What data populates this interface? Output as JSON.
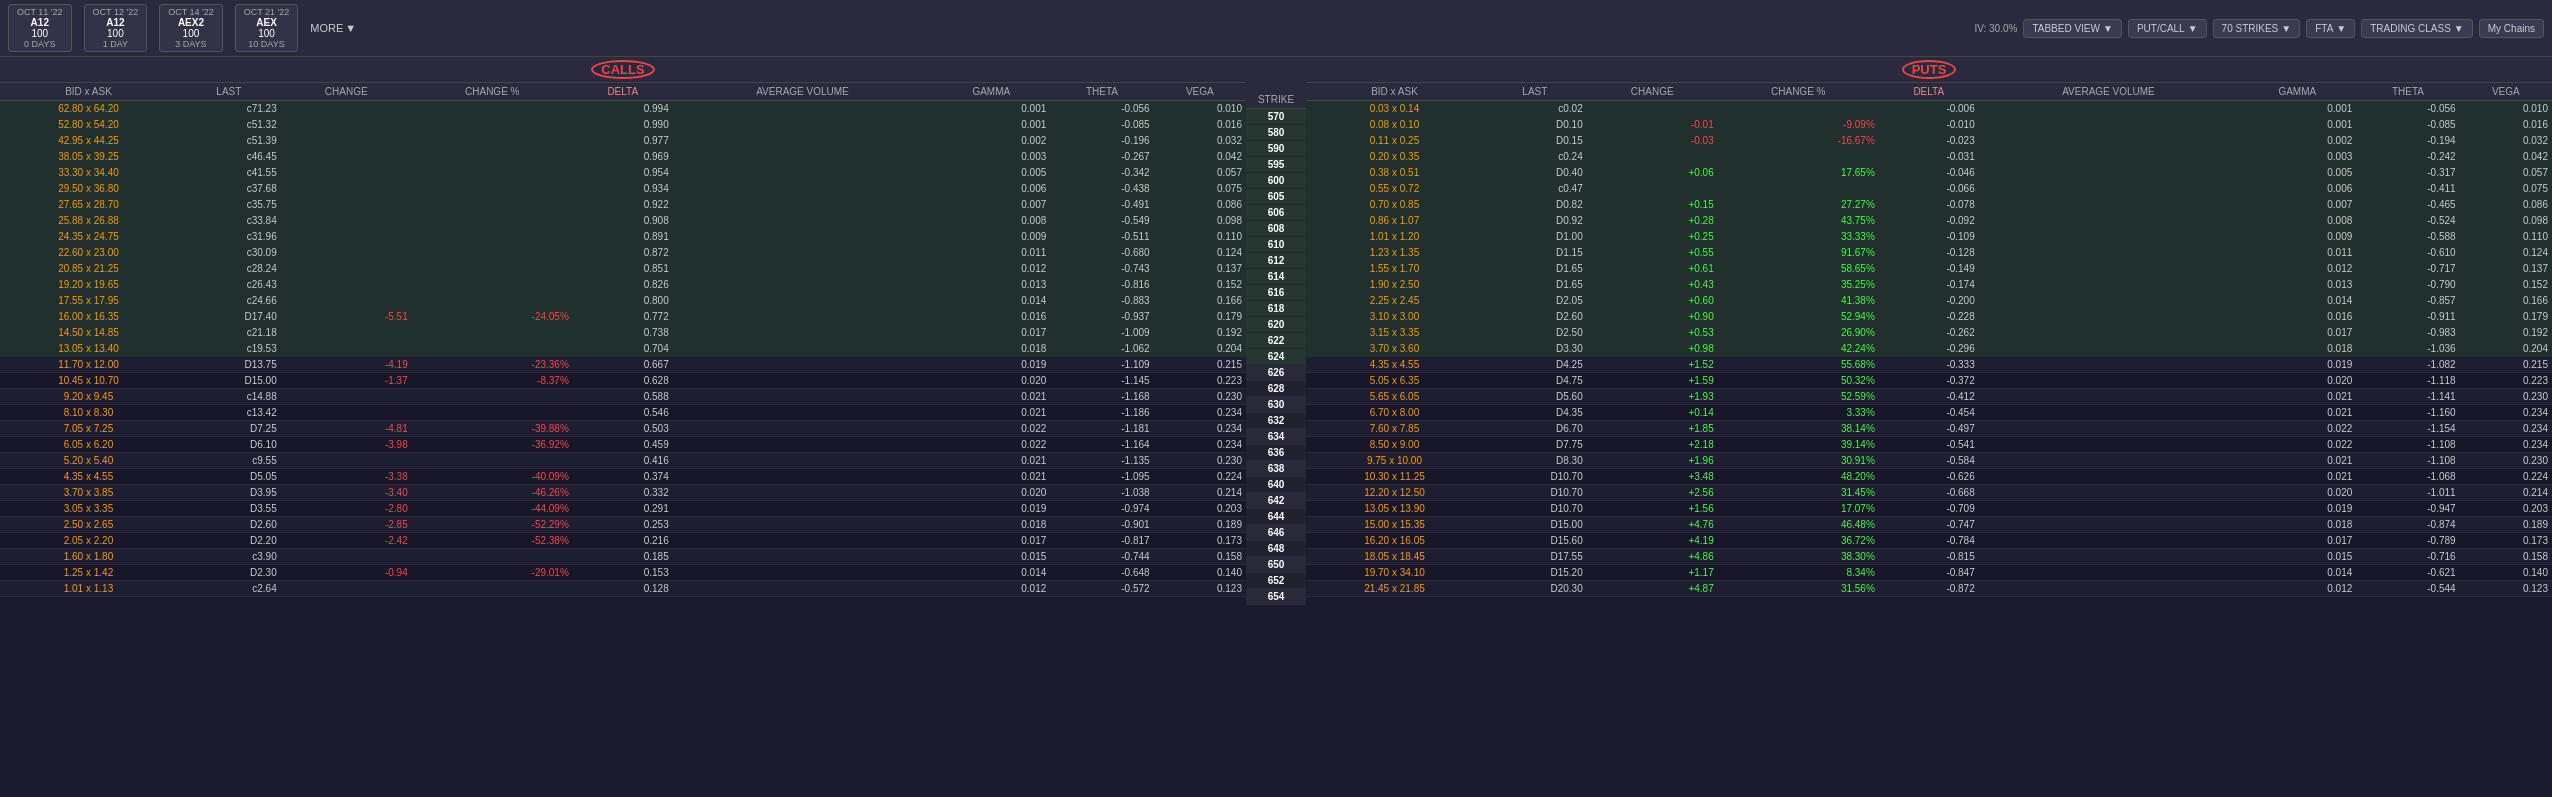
{
  "topbar": {
    "dates": [
      {
        "date": "OCT 11 '22",
        "sym": "A12",
        "price": "100",
        "days": "0 DAYS"
      },
      {
        "date": "OCT 12 '22",
        "sym": "A12",
        "price": "100",
        "days": "1 DAY"
      },
      {
        "date": "OCT 14 '22",
        "sym": "AEX2",
        "price": "100",
        "days": "3 DAYS"
      },
      {
        "date": "OCT 21 '22",
        "sym": "AEX",
        "price": "100",
        "days": "10 DAYS"
      }
    ],
    "more_label": "MORE",
    "tabbed_view": "TABBED VIEW",
    "put_call": "PUT/CALL",
    "strikes": "70 STRIKES",
    "fta": "FTA",
    "trading_class": "TRADING CLASS",
    "my_chains": "My Chains",
    "iv_label": "IV: 30.0%"
  },
  "calls_label": "CALLS",
  "puts_label": "PUTS",
  "columns": {
    "calls": [
      "BID x ASK",
      "LAST",
      "CHANGE",
      "CHANGE %",
      "DELTA",
      "AVERAGE VOLUME",
      "GAMMA",
      "THETA",
      "VEGA"
    ],
    "strike": "STRIKE",
    "puts": [
      "BID x ASK",
      "LAST",
      "CHANGE",
      "CHANGE %",
      "DELTA",
      "AVERAGE VOLUME",
      "GAMMA",
      "THETA",
      "VEGA"
    ]
  },
  "rows": [
    {
      "strike": 570,
      "itm": true,
      "call": {
        "bid_ask": "62.80 x 64.20",
        "last": "c71.23",
        "change": "",
        "change_pct": "",
        "delta": "0.994",
        "avg_vol": "",
        "gamma": "0.001",
        "theta": "-0.056",
        "vega": "0.010"
      },
      "put": {
        "bid_ask": "0.03 x 0.14",
        "last": "c0.02",
        "change": "",
        "change_pct": "",
        "delta": "-0.006",
        "avg_vol": "",
        "gamma": "0.001",
        "theta": "-0.056",
        "vega": "0.010"
      }
    },
    {
      "strike": 580,
      "itm": true,
      "call": {
        "bid_ask": "52.80 x 54.20",
        "last": "c51.32",
        "change": "",
        "change_pct": "",
        "delta": "0.990",
        "avg_vol": "",
        "gamma": "0.001",
        "theta": "-0.085",
        "vega": "0.016"
      },
      "put": {
        "bid_ask": "0.08 x 0.10",
        "last": "D0.10",
        "change": "-0.01",
        "change_pct": "-9.09%",
        "delta": "-0.010",
        "avg_vol": "",
        "gamma": "0.001",
        "theta": "-0.085",
        "vega": "0.016"
      }
    },
    {
      "strike": 590,
      "itm": true,
      "call": {
        "bid_ask": "42.95 x 44.25",
        "last": "c51.39",
        "change": "",
        "change_pct": "",
        "delta": "0.977",
        "avg_vol": "",
        "gamma": "0.002",
        "theta": "-0.196",
        "vega": "0.032"
      },
      "put": {
        "bid_ask": "0.11 x 0.25",
        "last": "D0.15",
        "change": "-0.03",
        "change_pct": "-16.67%",
        "delta": "-0.023",
        "avg_vol": "",
        "gamma": "0.002",
        "theta": "-0.194",
        "vega": "0.032"
      }
    },
    {
      "strike": 595,
      "itm": true,
      "call": {
        "bid_ask": "38.05 x 39.25",
        "last": "c46.45",
        "change": "",
        "change_pct": "",
        "delta": "0.969",
        "avg_vol": "",
        "gamma": "0.003",
        "theta": "-0.267",
        "vega": "0.042"
      },
      "put": {
        "bid_ask": "0.20 x 0.35",
        "last": "c0.24",
        "change": "",
        "change_pct": "",
        "delta": "-0.031",
        "avg_vol": "",
        "gamma": "0.003",
        "theta": "-0.242",
        "vega": "0.042"
      }
    },
    {
      "strike": 600,
      "itm": true,
      "call": {
        "bid_ask": "33.30 x 34.40",
        "last": "c41.55",
        "change": "",
        "change_pct": "",
        "delta": "0.954",
        "avg_vol": "",
        "gamma": "0.005",
        "theta": "-0.342",
        "vega": "0.057"
      },
      "put": {
        "bid_ask": "0.38 x 0.51",
        "last": "D0.40",
        "change": "+0.06",
        "change_pct": "17.65%",
        "delta": "-0.046",
        "avg_vol": "",
        "gamma": "0.005",
        "theta": "-0.317",
        "vega": "0.057"
      }
    },
    {
      "strike": 605,
      "itm": true,
      "call": {
        "bid_ask": "29.50 x 36.80",
        "last": "c37.68",
        "change": "",
        "change_pct": "",
        "delta": "0.934",
        "avg_vol": "",
        "gamma": "0.006",
        "theta": "-0.438",
        "vega": "0.075"
      },
      "put": {
        "bid_ask": "0.55 x 0.72",
        "last": "c0.47",
        "change": "",
        "change_pct": "",
        "delta": "-0.066",
        "avg_vol": "",
        "gamma": "0.006",
        "theta": "-0.411",
        "vega": "0.075"
      }
    },
    {
      "strike": 606,
      "itm": true,
      "call": {
        "bid_ask": "27.65 x 28.70",
        "last": "c35.75",
        "change": "",
        "change_pct": "",
        "delta": "0.922",
        "avg_vol": "",
        "gamma": "0.007",
        "theta": "-0.491",
        "vega": "0.086"
      },
      "put": {
        "bid_ask": "0.70 x 0.85",
        "last": "D0.82",
        "change": "+0.15",
        "change_pct": "27.27%",
        "delta": "-0.078",
        "avg_vol": "",
        "gamma": "0.007",
        "theta": "-0.465",
        "vega": "0.086"
      }
    },
    {
      "strike": 608,
      "itm": true,
      "call": {
        "bid_ask": "25.88 x 26.88",
        "last": "c33.84",
        "change": "",
        "change_pct": "",
        "delta": "0.908",
        "avg_vol": "",
        "gamma": "0.008",
        "theta": "-0.549",
        "vega": "0.098"
      },
      "put": {
        "bid_ask": "0.86 x 1.07",
        "last": "D0.92",
        "change": "+0.28",
        "change_pct": "43.75%",
        "delta": "-0.092",
        "avg_vol": "",
        "gamma": "0.008",
        "theta": "-0.524",
        "vega": "0.098"
      }
    },
    {
      "strike": 610,
      "itm": true,
      "call": {
        "bid_ask": "24.35 x 24.75",
        "last": "c31.96",
        "change": "",
        "change_pct": "",
        "delta": "0.891",
        "avg_vol": "",
        "gamma": "0.009",
        "theta": "-0.511",
        "vega": "0.110"
      },
      "put": {
        "bid_ask": "1.01 x 1.20",
        "last": "D1.00",
        "change": "+0.25",
        "change_pct": "33.33%",
        "delta": "-0.109",
        "avg_vol": "",
        "gamma": "0.009",
        "theta": "-0.588",
        "vega": "0.110"
      }
    },
    {
      "strike": 612,
      "itm": true,
      "call": {
        "bid_ask": "22.60 x 23.00",
        "last": "c30.09",
        "change": "",
        "change_pct": "",
        "delta": "0.872",
        "avg_vol": "",
        "gamma": "0.011",
        "theta": "-0.680",
        "vega": "0.124"
      },
      "put": {
        "bid_ask": "1.23 x 1.35",
        "last": "D1.15",
        "change": "+0.55",
        "change_pct": "91.67%",
        "delta": "-0.128",
        "avg_vol": "",
        "gamma": "0.011",
        "theta": "-0.610",
        "vega": "0.124"
      }
    },
    {
      "strike": 614,
      "itm": true,
      "call": {
        "bid_ask": "20.85 x 21.25",
        "last": "c28.24",
        "change": "",
        "change_pct": "",
        "delta": "0.851",
        "avg_vol": "",
        "gamma": "0.012",
        "theta": "-0.743",
        "vega": "0.137"
      },
      "put": {
        "bid_ask": "1.55 x 1.70",
        "last": "D1.65",
        "change": "+0.61",
        "change_pct": "58.65%",
        "delta": "-0.149",
        "avg_vol": "",
        "gamma": "0.012",
        "theta": "-0.717",
        "vega": "0.137"
      }
    },
    {
      "strike": 616,
      "itm": true,
      "call": {
        "bid_ask": "19.20 x 19.65",
        "last": "c26.43",
        "change": "",
        "change_pct": "",
        "delta": "0.826",
        "avg_vol": "",
        "gamma": "0.013",
        "theta": "-0.816",
        "vega": "0.152"
      },
      "put": {
        "bid_ask": "1.90 x 2.50",
        "last": "D1.65",
        "change": "+0.43",
        "change_pct": "35.25%",
        "delta": "-0.174",
        "avg_vol": "",
        "gamma": "0.013",
        "theta": "-0.790",
        "vega": "0.152"
      }
    },
    {
      "strike": 618,
      "itm": true,
      "call": {
        "bid_ask": "17.55 x 17.95",
        "last": "c24.66",
        "change": "",
        "change_pct": "",
        "delta": "0.800",
        "avg_vol": "",
        "gamma": "0.014",
        "theta": "-0.883",
        "vega": "0.166"
      },
      "put": {
        "bid_ask": "2.25 x 2.45",
        "last": "D2.05",
        "change": "+0.60",
        "change_pct": "41.38%",
        "delta": "-0.200",
        "avg_vol": "",
        "gamma": "0.014",
        "theta": "-0.857",
        "vega": "0.166"
      }
    },
    {
      "strike": 620,
      "itm": true,
      "call": {
        "bid_ask": "16.00 x 16.35",
        "last": "D17.40",
        "change": "-5.51",
        "change_pct": "-24.05%",
        "delta": "0.772",
        "avg_vol": "",
        "gamma": "0.016",
        "theta": "-0.937",
        "vega": "0.179"
      },
      "put": {
        "bid_ask": "3.10 x 3.00",
        "last": "D2.60",
        "change": "+0.90",
        "change_pct": "52.94%",
        "delta": "-0.228",
        "avg_vol": "",
        "gamma": "0.016",
        "theta": "-0.911",
        "vega": "0.179"
      }
    },
    {
      "strike": 622,
      "itm": true,
      "call": {
        "bid_ask": "14.50 x 14.85",
        "last": "c21.18",
        "change": "",
        "change_pct": "",
        "delta": "0.738",
        "avg_vol": "",
        "gamma": "0.017",
        "theta": "-1.009",
        "vega": "0.192"
      },
      "put": {
        "bid_ask": "3.15 x 3.35",
        "last": "D2.50",
        "change": "+0.53",
        "change_pct": "26.90%",
        "delta": "-0.262",
        "avg_vol": "",
        "gamma": "0.017",
        "theta": "-0.983",
        "vega": "0.192"
      }
    },
    {
      "strike": 624,
      "itm": true,
      "call": {
        "bid_ask": "13.05 x 13.40",
        "last": "c19.53",
        "change": "",
        "change_pct": "",
        "delta": "0.704",
        "avg_vol": "",
        "gamma": "0.018",
        "theta": "-1.062",
        "vega": "0.204"
      },
      "put": {
        "bid_ask": "3.70 x 3.60",
        "last": "D3.30",
        "change": "+0.98",
        "change_pct": "42.24%",
        "delta": "-0.296",
        "avg_vol": "",
        "gamma": "0.018",
        "theta": "-1.036",
        "vega": "0.204"
      }
    },
    {
      "strike": 626,
      "itm": false,
      "call": {
        "bid_ask": "11.70 x 12.00",
        "last": "D13.75",
        "change": "-4.19",
        "change_pct": "-23.36%",
        "delta": "0.667",
        "avg_vol": "",
        "gamma": "0.019",
        "theta": "-1.109",
        "vega": "0.215"
      },
      "put": {
        "bid_ask": "4.35 x 4.55",
        "last": "D4.25",
        "change": "+1.52",
        "change_pct": "55.68%",
        "delta": "-0.333",
        "avg_vol": "",
        "gamma": "0.019",
        "theta": "-1.082",
        "vega": "0.215"
      }
    },
    {
      "strike": 628,
      "itm": false,
      "call": {
        "bid_ask": "10.45 x 10.70",
        "last": "D15.00",
        "change": "-1.37",
        "change_pct": "-8.37%",
        "delta": "0.628",
        "avg_vol": "",
        "gamma": "0.020",
        "theta": "-1.145",
        "vega": "0.223"
      },
      "put": {
        "bid_ask": "5.05 x 6.35",
        "last": "D4.75",
        "change": "+1.59",
        "change_pct": "50.32%",
        "delta": "-0.372",
        "avg_vol": "",
        "gamma": "0.020",
        "theta": "-1.118",
        "vega": "0.223"
      }
    },
    {
      "strike": 630,
      "itm": false,
      "call": {
        "bid_ask": "9.20 x 9.45",
        "last": "c14.88",
        "change": "",
        "change_pct": "",
        "delta": "0.588",
        "avg_vol": "",
        "gamma": "0.021",
        "theta": "-1.168",
        "vega": "0.230"
      },
      "put": {
        "bid_ask": "5.65 x 6.05",
        "last": "D5.60",
        "change": "+1.93",
        "change_pct": "52.59%",
        "delta": "-0.412",
        "avg_vol": "",
        "gamma": "0.021",
        "theta": "-1.141",
        "vega": "0.230"
      }
    },
    {
      "strike": 632,
      "itm": false,
      "call": {
        "bid_ask": "8.10 x 8.30",
        "last": "c13.42",
        "change": "",
        "change_pct": "",
        "delta": "0.546",
        "avg_vol": "",
        "gamma": "0.021",
        "theta": "-1.186",
        "vega": "0.234"
      },
      "put": {
        "bid_ask": "6.70 x 8.00",
        "last": "D4.35",
        "change": "+0.14",
        "change_pct": "3.33%",
        "delta": "-0.454",
        "avg_vol": "",
        "gamma": "0.021",
        "theta": "-1.160",
        "vega": "0.234"
      }
    },
    {
      "strike": 634,
      "itm": false,
      "call": {
        "bid_ask": "7.05 x 7.25",
        "last": "D7.25",
        "change": "-4.81",
        "change_pct": "-39.88%",
        "delta": "0.503",
        "avg_vol": "",
        "gamma": "0.022",
        "theta": "-1.181",
        "vega": "0.234"
      },
      "put": {
        "bid_ask": "7.60 x 7.85",
        "last": "D6.70",
        "change": "+1.85",
        "change_pct": "38.14%",
        "delta": "-0.497",
        "avg_vol": "",
        "gamma": "0.022",
        "theta": "-1.154",
        "vega": "0.234"
      }
    },
    {
      "strike": 636,
      "itm": false,
      "call": {
        "bid_ask": "6.05 x 6.20",
        "last": "D6.10",
        "change": "-3.98",
        "change_pct": "-36.92%",
        "delta": "0.459",
        "avg_vol": "",
        "gamma": "0.022",
        "theta": "-1.164",
        "vega": "0.234"
      },
      "put": {
        "bid_ask": "8.50 x 9.00",
        "last": "D7.75",
        "change": "+2.18",
        "change_pct": "39.14%",
        "delta": "-0.541",
        "avg_vol": "",
        "gamma": "0.022",
        "theta": "-1.108",
        "vega": "0.234"
      }
    },
    {
      "strike": 638,
      "itm": false,
      "call": {
        "bid_ask": "5.20 x 5.40",
        "last": "c9.55",
        "change": "",
        "change_pct": "",
        "delta": "0.416",
        "avg_vol": "",
        "gamma": "0.021",
        "theta": "-1.135",
        "vega": "0.230"
      },
      "put": {
        "bid_ask": "9.75 x 10.00",
        "last": "D8.30",
        "change": "+1.96",
        "change_pct": "30.91%",
        "delta": "-0.584",
        "avg_vol": "",
        "gamma": "0.021",
        "theta": "-1.108",
        "vega": "0.230"
      }
    },
    {
      "strike": 640,
      "itm": false,
      "call": {
        "bid_ask": "4.35 x 4.55",
        "last": "D5.05",
        "change": "-3.38",
        "change_pct": "-40.09%",
        "delta": "0.374",
        "avg_vol": "",
        "gamma": "0.021",
        "theta": "-1.095",
        "vega": "0.224"
      },
      "put": {
        "bid_ask": "10.30 x 11.25",
        "last": "D10.70",
        "change": "+3.48",
        "change_pct": "48.20%",
        "delta": "-0.626",
        "avg_vol": "",
        "gamma": "0.021",
        "theta": "-1.068",
        "vega": "0.224"
      }
    },
    {
      "strike": 642,
      "itm": false,
      "call": {
        "bid_ask": "3.70 x 3.85",
        "last": "D3.95",
        "change": "-3.40",
        "change_pct": "-46.26%",
        "delta": "0.332",
        "avg_vol": "",
        "gamma": "0.020",
        "theta": "-1.038",
        "vega": "0.214"
      },
      "put": {
        "bid_ask": "12.20 x 12.50",
        "last": "D10.70",
        "change": "+2.56",
        "change_pct": "31.45%",
        "delta": "-0.668",
        "avg_vol": "",
        "gamma": "0.020",
        "theta": "-1.011",
        "vega": "0.214"
      }
    },
    {
      "strike": 644,
      "itm": false,
      "call": {
        "bid_ask": "3.05 x 3.35",
        "last": "D3.55",
        "change": "-2.80",
        "change_pct": "-44.09%",
        "delta": "0.291",
        "avg_vol": "",
        "gamma": "0.019",
        "theta": "-0.974",
        "vega": "0.203"
      },
      "put": {
        "bid_ask": "13.05 x 13.90",
        "last": "D10.70",
        "change": "+1.56",
        "change_pct": "17.07%",
        "delta": "-0.709",
        "avg_vol": "",
        "gamma": "0.019",
        "theta": "-0.947",
        "vega": "0.203"
      }
    },
    {
      "strike": 646,
      "itm": false,
      "call": {
        "bid_ask": "2.50 x 2.65",
        "last": "D2.60",
        "change": "-2.85",
        "change_pct": "-52.29%",
        "delta": "0.253",
        "avg_vol": "",
        "gamma": "0.018",
        "theta": "-0.901",
        "vega": "0.189"
      },
      "put": {
        "bid_ask": "15.00 x 15.35",
        "last": "D15.00",
        "change": "+4.76",
        "change_pct": "46.48%",
        "delta": "-0.747",
        "avg_vol": "",
        "gamma": "0.018",
        "theta": "-0.874",
        "vega": "0.189"
      }
    },
    {
      "strike": 648,
      "itm": false,
      "call": {
        "bid_ask": "2.05 x 2.20",
        "last": "D2.20",
        "change": "-2.42",
        "change_pct": "-52.38%",
        "delta": "0.216",
        "avg_vol": "",
        "gamma": "0.017",
        "theta": "-0.817",
        "vega": "0.173"
      },
      "put": {
        "bid_ask": "16.20 x 16.05",
        "last": "D15.60",
        "change": "+4.19",
        "change_pct": "36.72%",
        "delta": "-0.784",
        "avg_vol": "",
        "gamma": "0.017",
        "theta": "-0.789",
        "vega": "0.173"
      }
    },
    {
      "strike": 650,
      "itm": false,
      "call": {
        "bid_ask": "1.60 x 1.80",
        "last": "c3.90",
        "change": "",
        "change_pct": "",
        "delta": "0.185",
        "avg_vol": "",
        "gamma": "0.015",
        "theta": "-0.744",
        "vega": "0.158"
      },
      "put": {
        "bid_ask": "18.05 x 18.45",
        "last": "D17.55",
        "change": "+4.86",
        "change_pct": "38.30%",
        "delta": "-0.815",
        "avg_vol": "",
        "gamma": "0.015",
        "theta": "-0.716",
        "vega": "0.158"
      }
    },
    {
      "strike": 652,
      "itm": false,
      "call": {
        "bid_ask": "1.25 x 1.42",
        "last": "D2.30",
        "change": "-0.94",
        "change_pct": "-29.01%",
        "delta": "0.153",
        "avg_vol": "",
        "gamma": "0.014",
        "theta": "-0.648",
        "vega": "0.140"
      },
      "put": {
        "bid_ask": "19.70 x 34.10",
        "last": "D15.20",
        "change": "+1.17",
        "change_pct": "8.34%",
        "delta": "-0.847",
        "avg_vol": "",
        "gamma": "0.014",
        "theta": "-0.621",
        "vega": "0.140"
      }
    },
    {
      "strike": 654,
      "itm": false,
      "call": {
        "bid_ask": "1.01 x 1.13",
        "last": "c2.64",
        "change": "",
        "change_pct": "",
        "delta": "0.128",
        "avg_vol": "",
        "gamma": "0.012",
        "theta": "-0.572",
        "vega": "0.123"
      },
      "put": {
        "bid_ask": "21.45 x 21.85",
        "last": "D20.30",
        "change": "+4.87",
        "change_pct": "31.56%",
        "delta": "-0.872",
        "avg_vol": "",
        "gamma": "0.012",
        "theta": "-0.544",
        "vega": "0.123"
      }
    }
  ]
}
